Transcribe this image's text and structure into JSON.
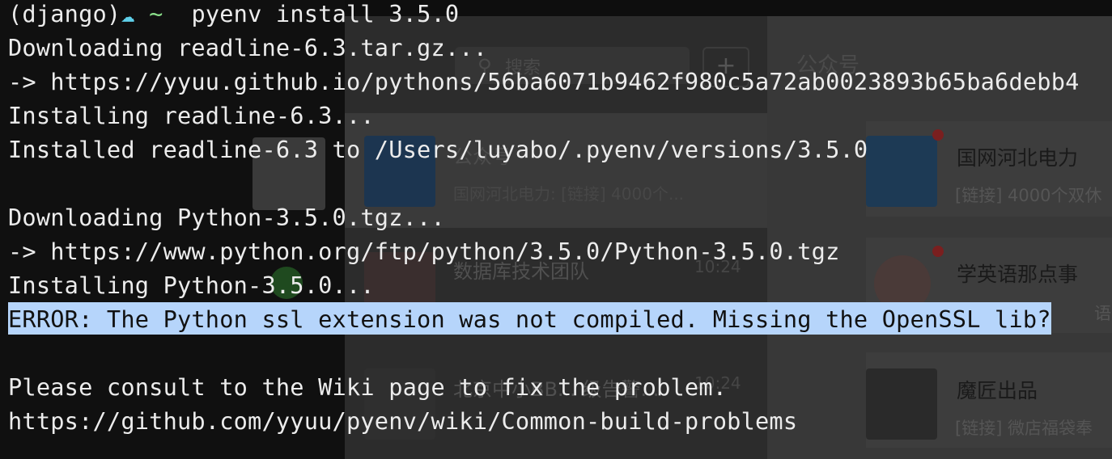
{
  "terminal": {
    "prompt_env": "(django)",
    "prompt_symbol": "☁",
    "prompt_dir": "~",
    "command": "pyenv install 3.5.0",
    "lines": [
      "Downloading readline-6.3.tar.gz...",
      "-> https://yyuu.github.io/pythons/56ba6071b9462f980c5a72ab0023893b65ba6debb4",
      "Installing readline-6.3...",
      "Installed readline-6.3 to /Users/luyabo/.pyenv/versions/3.5.0",
      "",
      "Downloading Python-3.5.0.tgz...",
      "-> https://www.python.org/ftp/python/3.5.0/Python-3.5.0.tgz",
      "Installing Python-3.5.0...",
      "ERROR: The Python ssl extension was not compiled. Missing the OpenSSL lib?",
      "",
      "Please consult to the Wiki page to fix the problem.",
      "https://github.com/yyuu/pyenv/wiki/Common-build-problems"
    ]
  },
  "background_app": {
    "search_placeholder": "搜索",
    "add_symbol": "+",
    "pane_title": "公众号",
    "chat_list": [
      {
        "title": "公众号",
        "preview": "国网河北电力: [链接] 4000个..."
      },
      {
        "title": "数据库技术团队",
        "time": "10:24"
      },
      {
        "title": "北京中小BB... 级告警...",
        "time": "10:24"
      }
    ],
    "accounts": [
      {
        "name": "国网河北电力",
        "preview": "[链接] 4000个双休"
      },
      {
        "name": "学英语那点事",
        "preview": "语"
      },
      {
        "name": "魔匠出品",
        "preview": "[链接] 微店福袋奉"
      }
    ]
  },
  "colors": {
    "terminal_bg": "#0e0e0e",
    "terminal_fg": "#ececec",
    "selection": "#b6d5fb",
    "prompt_cloud": "#5fd0ea",
    "prompt_tilde": "#8be08b"
  }
}
